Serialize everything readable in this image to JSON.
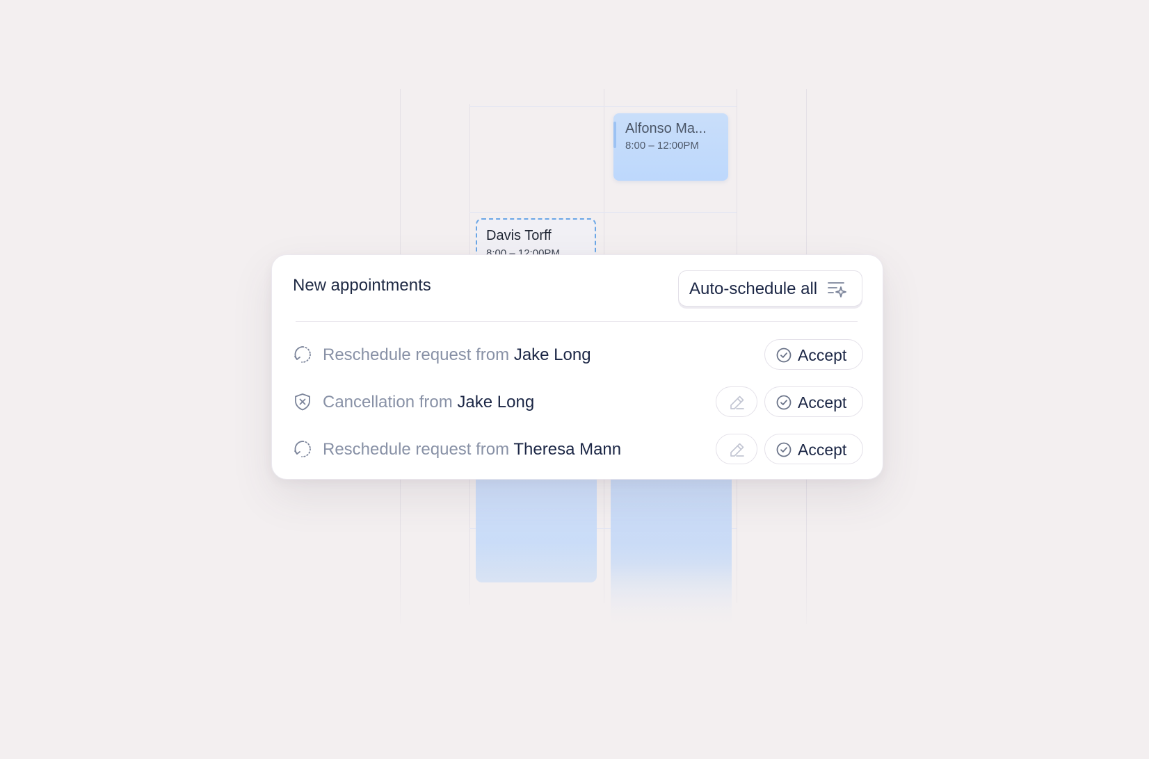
{
  "calendar": {
    "events": [
      {
        "title": "Alfonso Ma...",
        "time": "8:00 – 12:00PM"
      },
      {
        "title": "Davis Torff",
        "time": "8:00 – 12:00PM"
      }
    ]
  },
  "panel": {
    "title": "New appointments",
    "auto_schedule_label": "Auto-schedule all",
    "rows": [
      {
        "icon": "reschedule-icon",
        "lead": "Reschedule request from ",
        "name": "Jake Long",
        "has_edit": false,
        "accept_label": "Accept"
      },
      {
        "icon": "cancel-shield-icon",
        "lead": "Cancellation from ",
        "name": "Jake Long",
        "has_edit": true,
        "accept_label": "Accept"
      },
      {
        "icon": "reschedule-icon",
        "lead": "Reschedule request from ",
        "name": "Theresa Mann",
        "has_edit": true,
        "accept_label": "Accept"
      }
    ]
  },
  "colors": {
    "background": "#f3eff0",
    "event_fill": "#bdd8fc",
    "pending_border": "#6aa6e6",
    "text_primary": "#1b2645",
    "text_secondary": "#8891a6"
  }
}
